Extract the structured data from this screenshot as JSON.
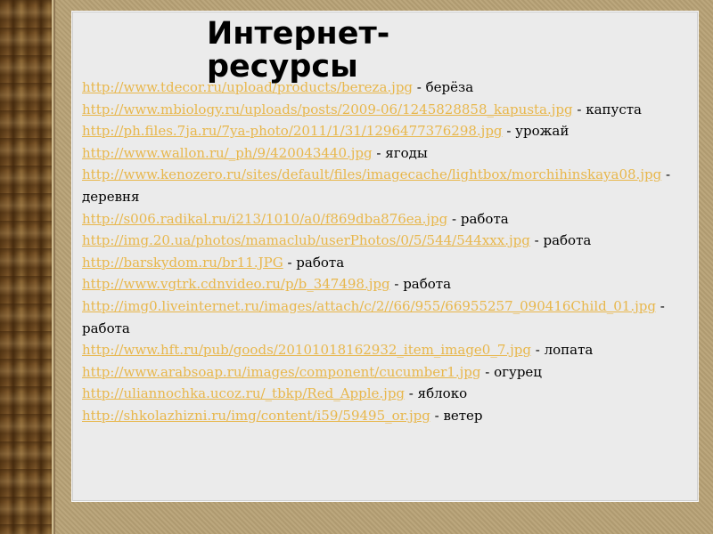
{
  "title": "Интернет-ресурсы",
  "links": [
    {
      "url": "http://www.tdecor.ru/upload/products/bereza.jpg",
      "label": "берёза"
    },
    {
      "url": "http://www.mbiology.ru/uploads/posts/2009-06/1245828858_kapusta.jpg",
      "label": "капуста"
    },
    {
      "url": "http://ph.files.7ja.ru/7ya-photo/2011/1/31/1296477376298.jpg",
      "label": "урожай"
    },
    {
      "url": "http://www.wallon.ru/_ph/9/420043440.jpg",
      "label": "ягоды"
    },
    {
      "url": "http://www.kenozero.ru/sites/default/files/imagecache/lightbox/morchihinskaya08.jpg",
      "label": "деревня"
    },
    {
      "url": "http://s006.radikal.ru/i213/1010/a0/f869dba876ea.jpg",
      "label": "работа"
    },
    {
      "url": "http://img.20.ua/photos/mamaclub/userPhotos/0/5/544/544xxx.jpg",
      "label": "работа"
    },
    {
      "url": "http://barskydom.ru/br11.JPG",
      "label": "работа"
    },
    {
      "url": "http://www.vgtrk.cdnvideo.ru/p/b_347498.jpg",
      "label": "работа"
    },
    {
      "url": "http://img0.liveinternet.ru/images/attach/c/2//66/955/66955257_090416Child_01.jpg",
      "label": "работа"
    },
    {
      "url": "http://www.hft.ru/pub/goods/20101018162932_item_image0_7.jpg",
      "label": "лопата"
    },
    {
      "url": "http://www.arabsoap.ru/images/component/cucumber1.jpg",
      "label": "огурец"
    },
    {
      "url": "http://uliannochka.ucoz.ru/_tbkp/Red_Apple.jpg",
      "label": "яблоко"
    },
    {
      "url": "http://shkolazhizni.ru/img/content/i59/59495_or.jpg",
      "label": "ветер"
    }
  ],
  "separator": " - ",
  "colors": {
    "link": "#e8b74c",
    "panel": "#ebebeb",
    "frame": "#b8a276"
  }
}
